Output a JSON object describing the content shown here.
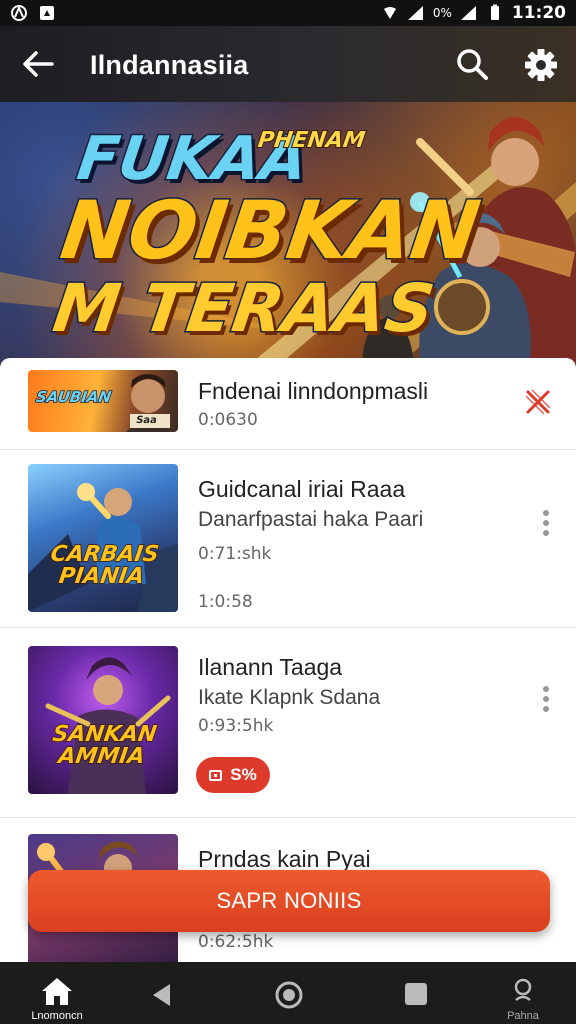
{
  "status_bar": {
    "time": "11:20",
    "battery_percent": "0%"
  },
  "app_bar": {
    "title": "Ilndannasiia"
  },
  "banner": {
    "line1": "FUKAA",
    "line1_tag": "PHENAM",
    "line2": "NOIBKAN",
    "line3": "M TERAAS"
  },
  "list": [
    {
      "title": "Fndenai linndonpmasli",
      "meta": "0:0630",
      "thumb_label": "SAUBIAN",
      "thumb_sub": "Saa"
    },
    {
      "title": "Guidcanal iriai Raaa",
      "subtitle": "Danarfpastai haka Paari",
      "meta": "0:71:shk",
      "meta2": "1:0:58",
      "thumb_label": "CARBAIS PIANIA"
    },
    {
      "title": "Ilanann Taaga",
      "subtitle": "Ikate Klapnk Sdana",
      "meta": "0:93:5hk",
      "chip": "S%",
      "thumb_label": "SANKAN AMMIA"
    },
    {
      "title": "Prndas kain Pyai",
      "meta": "0:62:5hk"
    }
  ],
  "cta": {
    "label": "SAPR NONIIS"
  },
  "bottom_nav": {
    "home_label": "Lnomoncn",
    "profile_label": "Pahna"
  },
  "colors": {
    "accent": "#de3a2b",
    "cta": "#e44a26",
    "appbar": "#232226"
  }
}
